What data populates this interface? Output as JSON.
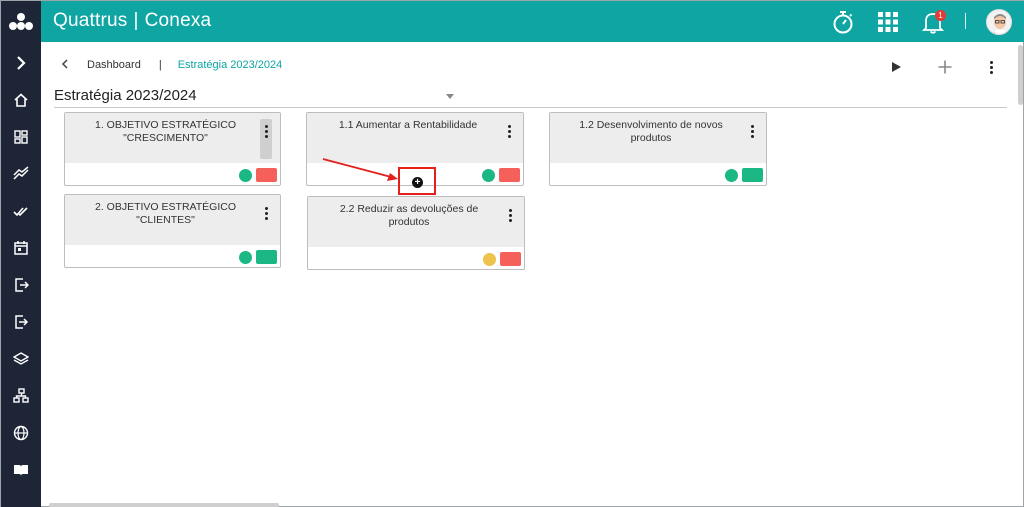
{
  "app": {
    "brand_left": "Quattrus",
    "brand_sep": "|",
    "brand_right": "Conexa",
    "notification_count": "1"
  },
  "colors": {
    "topbar": "#0ea5a3",
    "rail": "#1d2536",
    "green": "#1bb785",
    "red": "#f5605a",
    "yellow": "#eec34b",
    "highlight": "#e3201c"
  },
  "rail_icons": [
    "chevron-right-icon",
    "home-icon",
    "dashboard-icon",
    "trend-icon",
    "double-check-icon",
    "calendar-icon",
    "exit-icon",
    "logout-icon",
    "layers-icon",
    "sitemap-icon",
    "globe-icon",
    "book-icon"
  ],
  "breadcrumb": {
    "back_label": "<",
    "dashboard": "Dashboard",
    "separator": "|",
    "current": "Estratégia 2023/2024"
  },
  "page": {
    "title": "Estratégia 2023/2024"
  },
  "cards": {
    "c1": {
      "title": "1. OBJETIVO ESTRATÉGICO \"CRESCIMENTO\"",
      "dot": "green",
      "rect": "red"
    },
    "c2": {
      "title": "2. OBJETIVO ESTRATÉGICO \"CLIENTES\"",
      "dot": "green",
      "rect": "green"
    },
    "c3": {
      "title": "1.1 Aumentar a Rentabilidade",
      "dot": "green",
      "rect": "red"
    },
    "c4": {
      "title": "2.2 Reduzir as devoluções de produtos",
      "dot": "yellow",
      "rect": "red"
    },
    "c5": {
      "title": "1.2 Desenvolvimento de novos produtos",
      "dot": "green",
      "rect": "green"
    }
  },
  "add_child_label": "+"
}
